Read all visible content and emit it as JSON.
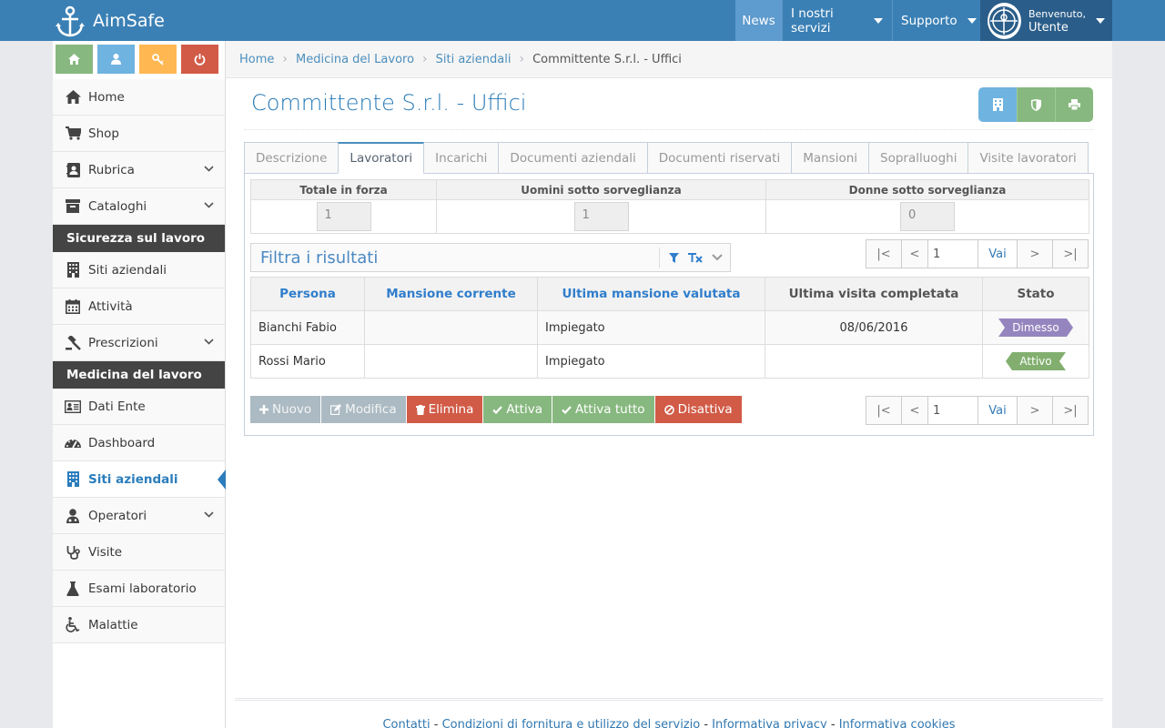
{
  "app": {
    "name": "AimSafe"
  },
  "navbar": {
    "news": "News",
    "servizi": "I nostri servizi",
    "supporto": "Supporto",
    "user_welcome": "Benvenuto,",
    "user_name": "Utente"
  },
  "shortcuts": [
    {
      "icon": "home-icon",
      "color": "#87b87f"
    },
    {
      "icon": "user-icon",
      "color": "#6fb3e0"
    },
    {
      "icon": "key-icon",
      "color": "#ffb752"
    },
    {
      "icon": "power-icon",
      "color": "#d15b47"
    }
  ],
  "sidebar": {
    "items_top": [
      {
        "label": "Home",
        "icon": "home-icon"
      },
      {
        "label": "Shop",
        "icon": "cart-icon"
      },
      {
        "label": "Rubrica",
        "icon": "address-book-icon",
        "submenu": true
      },
      {
        "label": "Cataloghi",
        "icon": "archive-icon",
        "submenu": true
      }
    ],
    "section1": "Sicurezza sul lavoro",
    "items_sic": [
      {
        "label": "Siti aziendali",
        "icon": "building-icon"
      },
      {
        "label": "Attività",
        "icon": "calendar-icon"
      },
      {
        "label": "Prescrizioni",
        "icon": "gavel-icon",
        "submenu": true
      }
    ],
    "section2": "Medicina del lavoro",
    "items_med": [
      {
        "label": "Dati Ente",
        "icon": "id-card-icon"
      },
      {
        "label": "Dashboard",
        "icon": "dashboard-icon"
      },
      {
        "label": "Siti aziendali",
        "icon": "building-icon",
        "active": true
      },
      {
        "label": "Operatori",
        "icon": "user-md-icon",
        "submenu": true
      },
      {
        "label": "Visite",
        "icon": "stethoscope-icon"
      },
      {
        "label": "Esami laboratorio",
        "icon": "flask-icon"
      },
      {
        "label": "Malattie",
        "icon": "wheelchair-icon"
      }
    ]
  },
  "breadcrumb": {
    "home": "Home",
    "b1": "Medicina del Lavoro",
    "b2": "Siti aziendali",
    "current": "Committente S.r.l. - Uffici"
  },
  "page": {
    "title": "Committente S.r.l. - Uffici"
  },
  "title_buttons": [
    {
      "icon": "building-icon",
      "color": "#6fb3e0"
    },
    {
      "icon": "shield-icon",
      "color": "#87b87f"
    },
    {
      "icon": "print-icon",
      "color": "#87b87f"
    }
  ],
  "tabs": [
    {
      "label": "Descrizione"
    },
    {
      "label": "Lavoratori",
      "active": true
    },
    {
      "label": "Incarichi"
    },
    {
      "label": "Documenti aziendali"
    },
    {
      "label": "Documenti riservati"
    },
    {
      "label": "Mansioni"
    },
    {
      "label": "Sopralluoghi"
    },
    {
      "label": "Visite lavoratori"
    }
  ],
  "summary": {
    "headers": [
      "Totale in forza",
      "Uomini sotto sorveglianza",
      "Donne sotto sorveglianza"
    ],
    "values": [
      "1",
      "1",
      "0"
    ]
  },
  "filter": {
    "placeholder": "Filtra i risultati"
  },
  "pager": {
    "first": "|<",
    "prev": "<",
    "page": "1",
    "go": "Vai",
    "next": ">",
    "last": ">|"
  },
  "grid": {
    "headers": [
      "Persona",
      "Mansione corrente",
      "Ultima mansione valutata",
      "Ultima visita completata",
      "Stato"
    ],
    "rows": [
      {
        "persona": "Bianchi Fabio",
        "mansione": "",
        "ultima_mansione": "Impiegato",
        "ultima_visita": "08/06/2016",
        "stato": "Dimesso",
        "stato_color": "#9585bf"
      },
      {
        "persona": "Rossi Mario",
        "mansione": "",
        "ultima_mansione": "Impiegato",
        "ultima_visita": "",
        "stato": "Attivo",
        "stato_color": "#82af6f"
      }
    ]
  },
  "actions": {
    "nuovo": "Nuovo",
    "modifica": "Modifica",
    "elimina": "Elimina",
    "attiva": "Attiva",
    "attiva_tutto": "Attiva tutto",
    "disattiva": "Disattiva"
  },
  "footer": {
    "contatti": "Contatti",
    "condizioni": "Condizioni di fornitura e utilizzo del servizio",
    "privacy": "Informativa privacy",
    "cookies": "Informativa cookies",
    "sep": " - "
  }
}
